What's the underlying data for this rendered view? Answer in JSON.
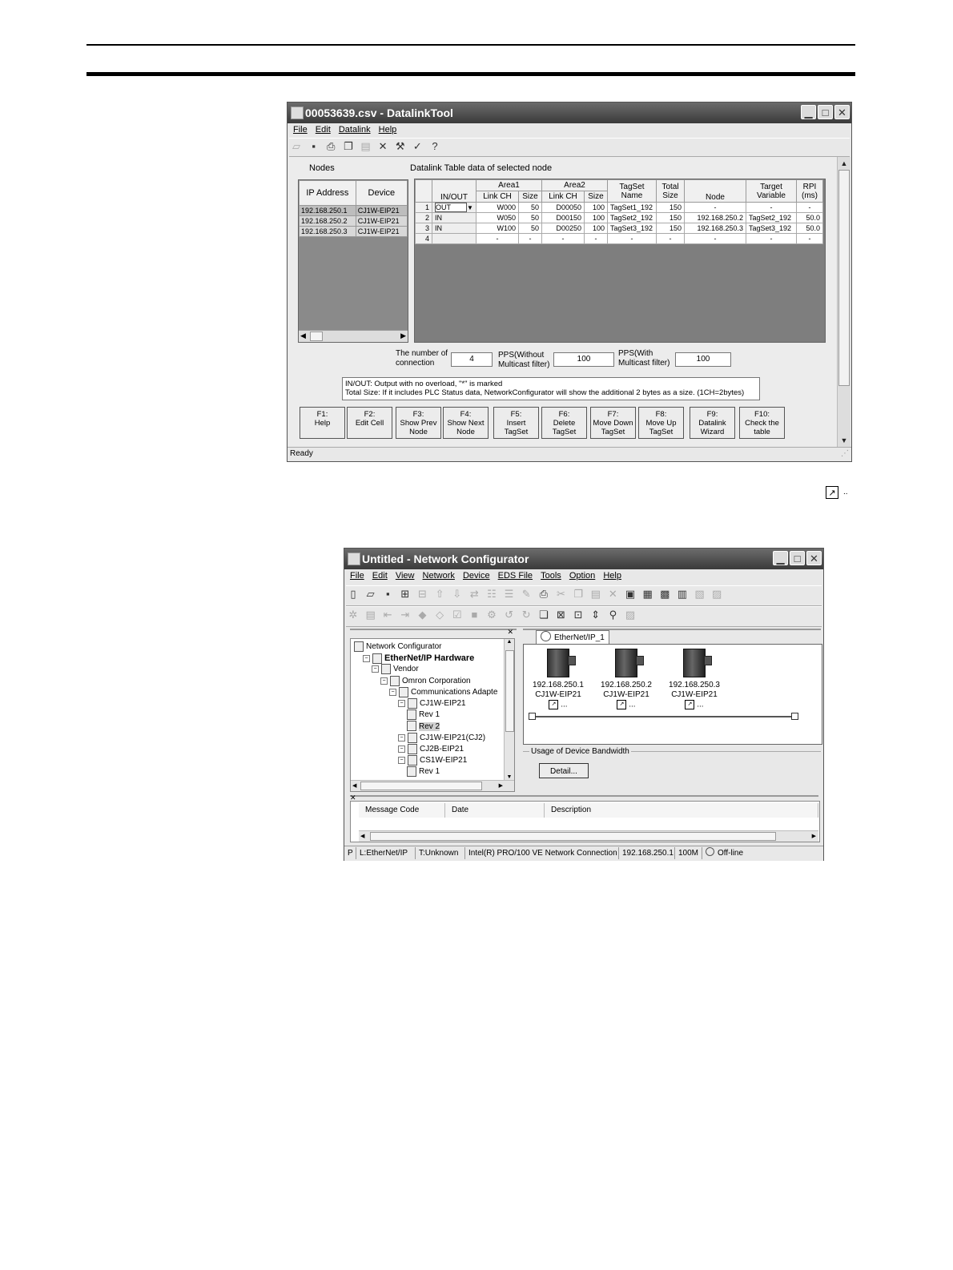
{
  "datalink": {
    "title": "00053639.csv - DatalinkTool",
    "menu": [
      "File",
      "Edit",
      "Datalink",
      "Help"
    ],
    "nodes_label": "Nodes",
    "table_label": "Datalink Table data of selected node",
    "nodes_headers": [
      "IP Address",
      "Device"
    ],
    "nodes": [
      {
        "ip": "192.168.250.1",
        "device": "CJ1W-EIP21"
      },
      {
        "ip": "192.168.250.2",
        "device": "CJ1W-EIP21"
      },
      {
        "ip": "192.168.250.3",
        "device": "CJ1W-EIP21"
      }
    ],
    "grid_headers": {
      "inout": "IN/OUT",
      "area1": "Area1",
      "area2": "Area2",
      "link_ch": "Link CH",
      "size": "Size",
      "tagset_name": "TagSet Name",
      "total_size": "Total Size",
      "node": "Node",
      "target_variable": "Target Variable",
      "rpi": "RPI (ms)"
    },
    "rows": [
      {
        "no": "1",
        "inout": "OUT",
        "a1ch": "W000",
        "a1size": "50",
        "a2ch": "D00050",
        "a2size": "100",
        "tagset": "TagSet1_192",
        "total": "150",
        "node": "-",
        "target": "-",
        "rpi": "-"
      },
      {
        "no": "2",
        "inout": "IN",
        "a1ch": "W050",
        "a1size": "50",
        "a2ch": "D00150",
        "a2size": "100",
        "tagset": "TagSet2_192",
        "total": "150",
        "node": "192.168.250.2",
        "target": "TagSet2_192",
        "rpi": "50.0"
      },
      {
        "no": "3",
        "inout": "IN",
        "a1ch": "W100",
        "a1size": "50",
        "a2ch": "D00250",
        "a2size": "100",
        "tagset": "TagSet3_192",
        "total": "150",
        "node": "192.168.250.3",
        "target": "TagSet3_192",
        "rpi": "50.0"
      },
      {
        "no": "4",
        "inout": "",
        "a1ch": "-",
        "a1size": "-",
        "a2ch": "-",
        "a2size": "-",
        "tagset": "-",
        "total": "-",
        "node": "-",
        "target": "-",
        "rpi": "-"
      }
    ],
    "conn_label": "The number of connection",
    "conn_value": "4",
    "pps_without_label": "PPS(Without Multicast filter)",
    "pps_without_value": "100",
    "pps_with_label": "PPS(With Multicast filter)",
    "pps_with_value": "100",
    "note_line1": "IN/OUT: Output with no overload, \"*\" is marked",
    "note_line2": "Total Size: If it includes PLC Status data, NetworkConfigurator will show the additional 2 bytes as a size. (1CH=2bytes)",
    "fbuttons": [
      "F1:\nHelp",
      "F2:\nEdit Cell",
      "F3:\nShow Prev\nNode",
      "F4:\nShow Next\nNode",
      "F5:\nInsert\nTagSet",
      "F6:\nDelete\nTagSet",
      "F7:\nMove Down\nTagSet",
      "F8:\nMove Up\nTagSet",
      "F9:\nDatalink\nWizard",
      "F10:\nCheck the\ntable"
    ],
    "status": "Ready"
  },
  "netconf": {
    "title": "Untitled - Network Configurator",
    "menu": [
      "File",
      "Edit",
      "View",
      "Network",
      "Device",
      "EDS File",
      "Tools",
      "Option",
      "Help"
    ],
    "tree": [
      {
        "label": "Network Configurator",
        "depth": 0,
        "bold": false
      },
      {
        "label": "EtherNet/IP Hardware",
        "depth": 1,
        "bold": true
      },
      {
        "label": "Vendor",
        "depth": 2,
        "bold": false
      },
      {
        "label": "Omron Corporation",
        "depth": 3,
        "bold": false
      },
      {
        "label": "Communications Adapte",
        "depth": 4,
        "bold": false
      },
      {
        "label": "CJ1W-EIP21",
        "depth": 5,
        "bold": false
      },
      {
        "label": "Rev 1",
        "depth": 6,
        "bold": false
      },
      {
        "label": "Rev 2",
        "depth": 6,
        "bold": false
      },
      {
        "label": "CJ1W-EIP21(CJ2)",
        "depth": 5,
        "bold": false
      },
      {
        "label": "CJ2B-EIP21",
        "depth": 5,
        "bold": false
      },
      {
        "label": "CS1W-EIP21",
        "depth": 5,
        "bold": false
      },
      {
        "label": "Rev 1",
        "depth": 6,
        "bold": false
      }
    ],
    "tab_label": "EtherNet/IP_1",
    "devices": [
      {
        "ip": "192.168.250.1",
        "model": "CJ1W-EIP21"
      },
      {
        "ip": "192.168.250.2",
        "model": "CJ1W-EIP21"
      },
      {
        "ip": "192.168.250.3",
        "model": "CJ1W-EIP21"
      }
    ],
    "device_link_text": "...",
    "bandwidth_label": "Usage of Device Bandwidth",
    "detail_button": "Detail...",
    "msg_headers": [
      "Message Code",
      "Date",
      "Description"
    ],
    "status": {
      "p0": "P",
      "p1": "L:EtherNet/IP",
      "p2": "T:Unknown",
      "p3": "Intel(R) PRO/100 VE Network Connection",
      "p4": "192.168.250.1",
      "p5": "100M",
      "p6": "Off-line"
    }
  },
  "between_icon_text": ".."
}
